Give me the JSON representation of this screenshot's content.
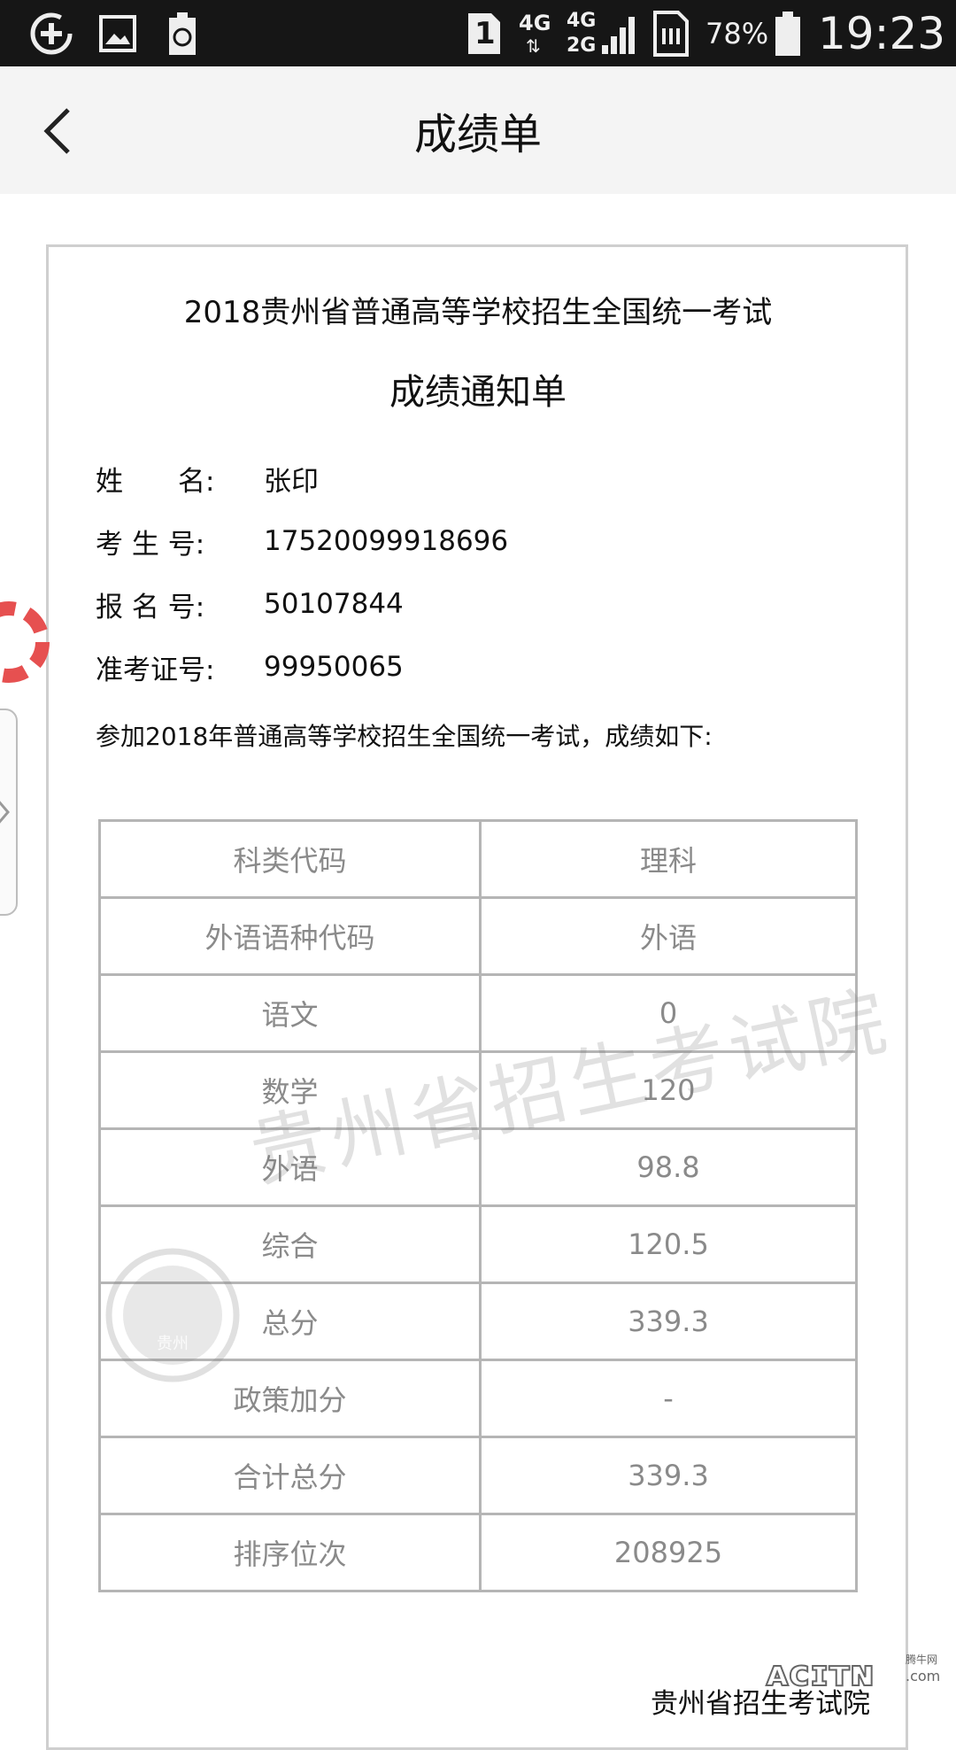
{
  "status_bar": {
    "sim_slot": "1",
    "network_primary": "4G",
    "network_secondary_top": "4G",
    "network_secondary_bottom": "2G",
    "battery_percent": "78%",
    "time": "19:23"
  },
  "app_bar": {
    "title": "成绩单"
  },
  "certificate": {
    "exam_title": "2018贵州省普通高等学校招生全国统一考试",
    "notice_title": "成绩通知单",
    "fields": [
      {
        "label": "姓　　名:",
        "value": "张印"
      },
      {
        "label": "考 生 号:",
        "value": "17520099918696"
      },
      {
        "label": "报 名 号:",
        "value": "50107844"
      },
      {
        "label": "准考证号:",
        "value": "99950065"
      }
    ],
    "intro": "参加2018年普通高等学校招生全国统一考试，成绩如下:",
    "scores": [
      {
        "subject": "科类代码",
        "value": "理科"
      },
      {
        "subject": "外语语种代码",
        "value": "外语"
      },
      {
        "subject": "语文",
        "value": "0"
      },
      {
        "subject": "数学",
        "value": "120"
      },
      {
        "subject": "外语",
        "value": "98.8"
      },
      {
        "subject": "综合",
        "value": "120.5"
      },
      {
        "subject": "总分",
        "value": "339.3"
      },
      {
        "subject": "政策加分",
        "value": "-"
      },
      {
        "subject": "合计总分",
        "value": "339.3"
      },
      {
        "subject": "排序位次",
        "value": "208925"
      }
    ],
    "watermark_text": "贵州省招生考试院",
    "seal_text": "贵州",
    "signoff": "贵州省招生考试院"
  },
  "corner_logo": {
    "text": "ᴀᴄɪᴛɴ",
    "small_text": "腾牛网",
    "suffix": ".com"
  },
  "colors": {
    "status_bar_bg": "#161616",
    "app_bar_bg": "#f4f4f4",
    "table_border": "#b5b5b5",
    "table_text": "#8a8a8a",
    "float_ring": "#e65050"
  },
  "icons": [
    "battery-saver-icon",
    "gallery-icon",
    "recycle-icon",
    "sim-card-icon",
    "signal-icon",
    "battery-icon",
    "back-arrow-icon",
    "lifebuoy-icon",
    "chevron-right-icon"
  ]
}
